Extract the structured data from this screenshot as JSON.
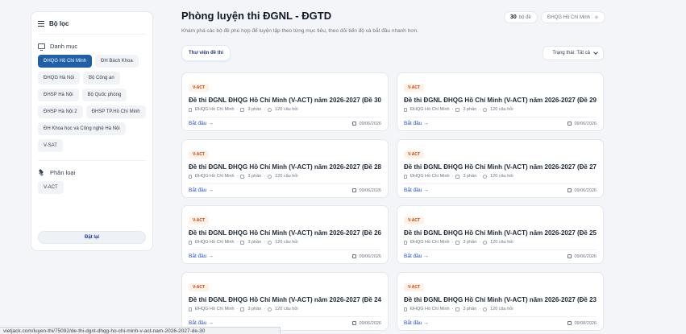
{
  "sidebar": {
    "heading": "Bộ lọc",
    "category_title": "Danh mục",
    "categories": [
      "ĐHQG Hồ Chí Minh",
      "ĐH Bách Khoa",
      "ĐHQG Hà Nội",
      "Bộ Công an",
      "ĐHSP Hà Nội",
      "Bộ Quốc phòng",
      "ĐHSP Hà Nội 2",
      "ĐHSP TP.Hồ Chí Minh",
      "ĐH Khoa học và Công nghệ Hà Nội",
      "V-SAT"
    ],
    "active_category": "ĐHQG Hồ Chí Minh",
    "classify_title": "Phân loại",
    "types": [
      "V-ACT"
    ],
    "reset_label": "Đặt lại"
  },
  "header": {
    "title": "Phòng luyện thi ĐGNL - ĐGTD",
    "subtitle": "Khám phá các bộ đề phù hợp để luyện tập theo từng mục tiêu, theo dõi tiến độ và bắt đầu nhanh hơn.",
    "count_number": "30",
    "count_unit": "bộ đề",
    "university": "ĐHQG Hồ Chí Minh"
  },
  "tabs": {
    "library": "Thư viện đề thi"
  },
  "status_filter": "Trạng thái: Tất cả",
  "cards": [
    {
      "badge": "V-ACT",
      "title": "Đề thi ĐGNL ĐHQG Hồ Chí Minh (V-ACT) năm 2026-2027 (Đề 30)",
      "university": "ĐHQG Hồ Chí Minh",
      "parts": "3 phần",
      "questions": "120 câu hỏi",
      "start": "Bắt đầu →",
      "date": "09/06/2026"
    },
    {
      "badge": "V-ACT",
      "title": "Đề thi ĐGNL ĐHQG Hồ Chí Minh (V-ACT) năm 2026-2027 (Đề 29)",
      "university": "ĐHQG Hồ Chí Minh",
      "parts": "3 phần",
      "questions": "120 câu hỏi",
      "start": "Bắt đầu →",
      "date": "09/06/2026"
    },
    {
      "badge": "V-ACT",
      "title": "Đề thi ĐGNL ĐHQG Hồ Chí Minh (V-ACT) năm 2026-2027 (Đề 28)",
      "university": "ĐHQG Hồ Chí Minh",
      "parts": "3 phần",
      "questions": "120 câu hỏi",
      "start": "Bắt đầu →",
      "date": "09/06/2026"
    },
    {
      "badge": "V-ACT",
      "title": "Đề thi ĐGNL ĐHQG Hồ Chí Minh (V-ACT) năm 2026-2027 (Đề 27)",
      "university": "ĐHQG Hồ Chí Minh",
      "parts": "3 phần",
      "questions": "120 câu hỏi",
      "start": "Bắt đầu →",
      "date": "09/06/2026"
    },
    {
      "badge": "V-ACT",
      "title": "Đề thi ĐGNL ĐHQG Hồ Chí Minh (V-ACT) năm 2026-2027 (Đề 26)",
      "university": "ĐHQG Hồ Chí Minh",
      "parts": "3 phần",
      "questions": "120 câu hỏi",
      "start": "Bắt đầu →",
      "date": "09/06/2026"
    },
    {
      "badge": "V-ACT",
      "title": "Đề thi ĐGNL ĐHQG Hồ Chí Minh (V-ACT) năm 2026-2027 (Đề 25)",
      "university": "ĐHQG Hồ Chí Minh",
      "parts": "3 phần",
      "questions": "120 câu hỏi",
      "start": "Bắt đầu →",
      "date": "09/06/2026"
    },
    {
      "badge": "V-ACT",
      "title": "Đề thi ĐGNL ĐHQG Hồ Chí Minh (V-ACT) năm 2026-2027 (Đề 24)",
      "university": "ĐHQG Hồ Chí Minh",
      "parts": "3 phần",
      "questions": "120 câu hỏi",
      "start": "Bắt đầu →",
      "date": "09/06/2026"
    },
    {
      "badge": "V-ACT",
      "title": "Đề thi ĐGNL ĐHQG Hồ Chí Minh (V-ACT) năm 2026-2027 (Đề 23)",
      "university": "ĐHQG Hồ Chí Minh",
      "parts": "3 phần",
      "questions": "120 câu hỏi",
      "start": "Bắt đầu →",
      "date": "09/08/2026"
    }
  ],
  "status_url": "vietjack.com/luyen-thi/75092/de-thi-dgnl-dhqg-ho-chi-minh-v-act-nam-2026-2027-de-30"
}
